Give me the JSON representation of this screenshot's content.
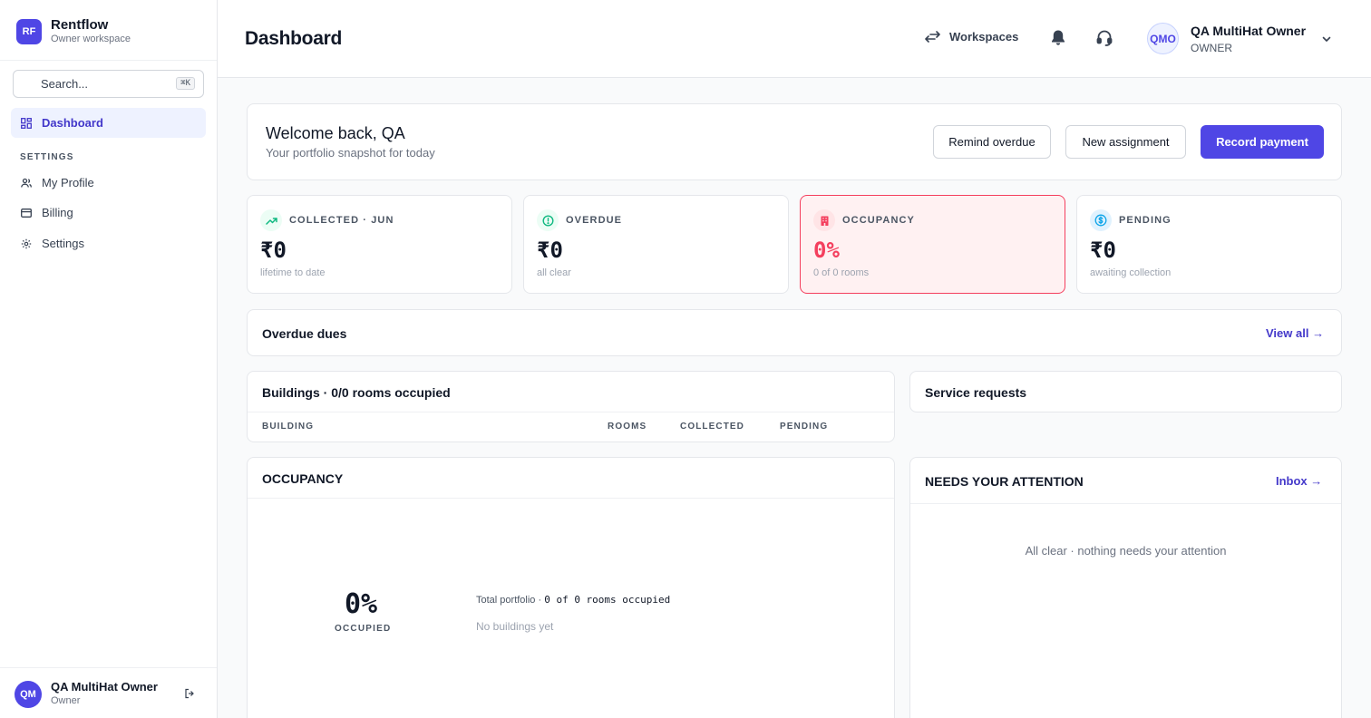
{
  "sidebar": {
    "brand_initials": "RF",
    "brand_name": "Rentflow",
    "brand_sub": "Owner workspace",
    "search_placeholder": "Search...",
    "search_shortcut": "⌘K",
    "nav_dashboard": "Dashboard",
    "section_settings": "SETTINGS",
    "nav_profile": "My Profile",
    "nav_billing": "Billing",
    "nav_settings": "Settings",
    "user_initials": "QM",
    "user_name": "QA MultiHat Owner",
    "user_role": "Owner"
  },
  "header": {
    "title": "Dashboard",
    "workspaces": "Workspaces",
    "avatar_initials": "QMO",
    "owner_name": "QA MultiHat Owner",
    "owner_role": "OWNER"
  },
  "welcome": {
    "title": "Welcome back, QA",
    "subtitle": "Your portfolio snapshot for today",
    "btn_remind": "Remind overdue",
    "btn_assignment": "New assignment",
    "btn_record": "Record payment"
  },
  "stats": [
    {
      "label": "COLLECTED · JUN",
      "value": "₹0",
      "sub": "lifetime to date"
    },
    {
      "label": "OVERDUE",
      "value": "₹0",
      "sub": "all clear"
    },
    {
      "label": "OCCUPANCY",
      "value": "0%",
      "sub": "0 of 0 rooms"
    },
    {
      "label": "PENDING",
      "value": "₹0",
      "sub": "awaiting collection"
    }
  ],
  "overdue": {
    "title": "Overdue dues",
    "link": "View all →"
  },
  "buildings": {
    "title": "Buildings · 0/0 rooms occupied",
    "columns": [
      "BUILDING",
      "ROOMS",
      "COLLECTED",
      "PENDING"
    ]
  },
  "service": {
    "title": "Service requests"
  },
  "occupancy": {
    "title": "OCCUPANCY",
    "value": "0%",
    "value_label": "OCCUPIED",
    "total_prefix": "Total portfolio · ",
    "total_value": "0 of 0 rooms occupied",
    "empty": "No buildings yet"
  },
  "attention": {
    "title": "NEEDS YOUR ATTENTION",
    "link": "Inbox →",
    "empty": "All clear · nothing needs your attention"
  },
  "colors": {
    "accent": "#4f46e5",
    "alert": "#f43f5e",
    "success": "#10b981",
    "info": "#0ea5e9"
  }
}
